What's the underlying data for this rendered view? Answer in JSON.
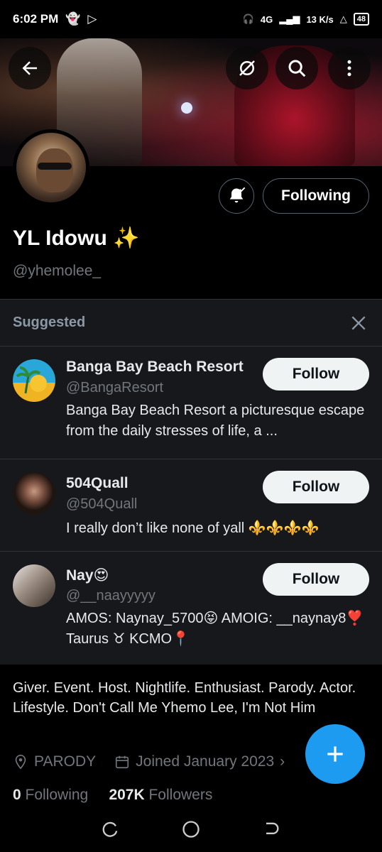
{
  "status_bar": {
    "time": "6:02 PM",
    "network": "4G",
    "sim": "13 K/s",
    "battery": "48"
  },
  "profile": {
    "display_name": "YL Idowu ✨",
    "handle": "@yhemolee_",
    "following_label": "Following"
  },
  "suggested": {
    "title": "Suggested",
    "items": [
      {
        "name": "Banga Bay Beach Resort",
        "handle": "@BangaResort",
        "bio": "Banga Bay Beach Resort  a picturesque escape from the daily stresses of life, a ...",
        "button": "Follow"
      },
      {
        "name": "504Quall",
        "handle": "@504Quall",
        "bio": "I really don’t like none of yall ⚜️⚜️⚜️⚜️",
        "button": "Follow"
      },
      {
        "name": "Nay😍",
        "handle": "@__naayyyyy",
        "bio": "AMOS: Naynay_5700😝 AMOIG: __naynay8❣️ Taurus ♉ KCMO📍",
        "button": "Follow"
      }
    ]
  },
  "bio": "Giver. Event. Host. Nightlife. Enthusiast. Parody. Actor. Lifestyle. Don't Call Me Yhemo Lee, I'm Not Him",
  "meta": {
    "location": "PARODY",
    "joined": "Joined January 2023"
  },
  "counts": {
    "following_num": "0",
    "following_label": "Following",
    "followers_num": "207K",
    "followers_label": "Followers"
  },
  "icons": {
    "accent": "#1d9bf0"
  }
}
